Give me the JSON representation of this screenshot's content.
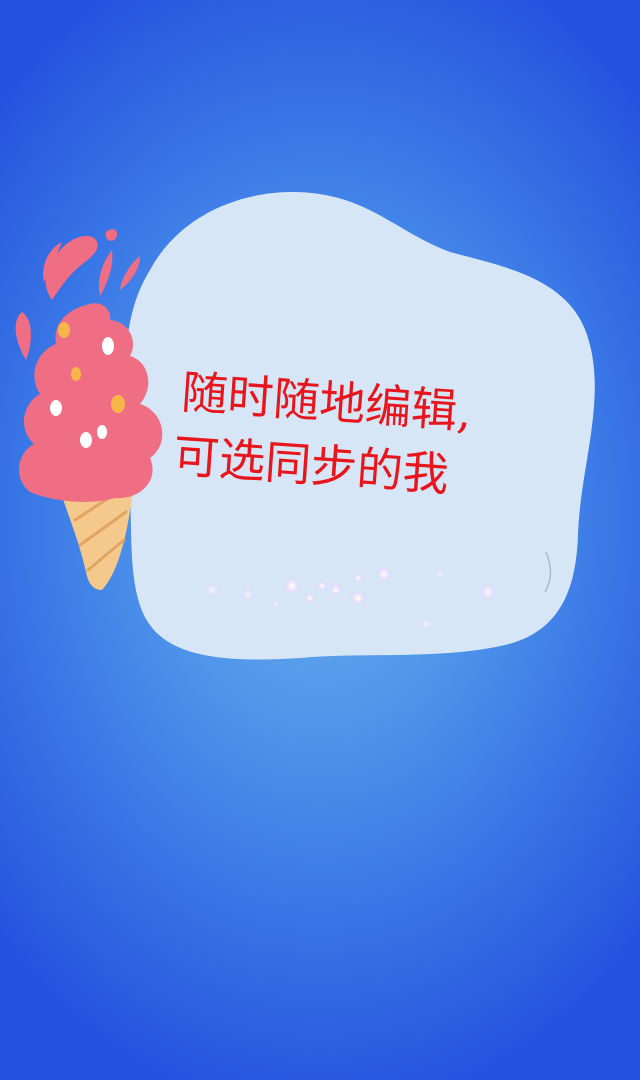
{
  "splash": {
    "slogan_line1": "随时随地编辑,",
    "slogan_line2": "可选同步的我"
  },
  "colors": {
    "background_center": "#6cb0ee",
    "background_edge": "#2652df",
    "bubble": "#d6e6f7",
    "slogan_text": "#e8161c",
    "ice_cream": "#f06e84",
    "cone": "#f5c98c"
  },
  "icons": {
    "illustration": "ice-cream-icon",
    "sparkles": "sparkle-icon"
  }
}
